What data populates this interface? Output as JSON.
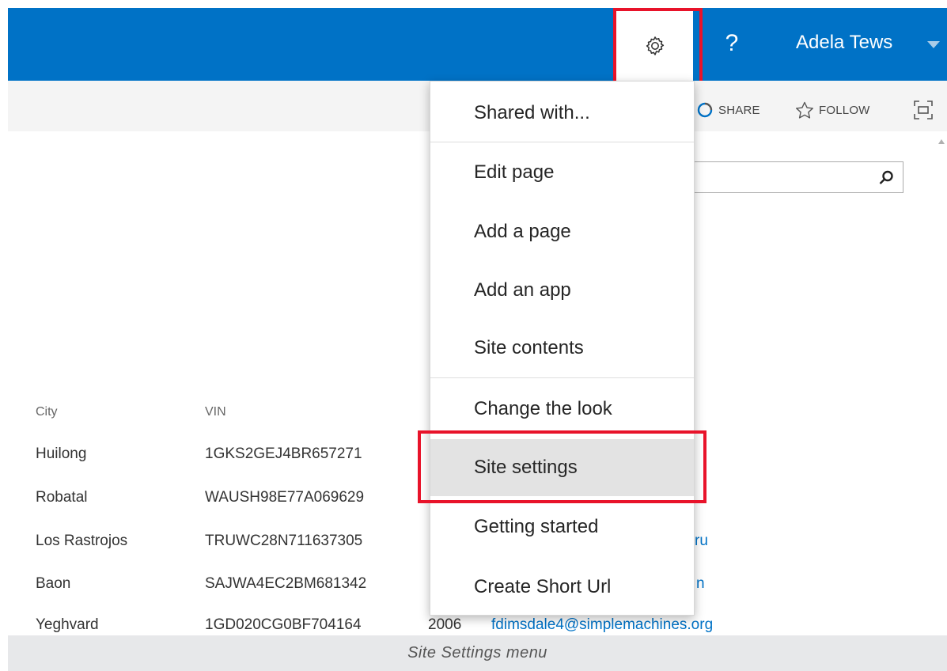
{
  "suitebar": {
    "help_label": "?",
    "user_name": "Adela Tews",
    "brand_color": "#0072c6",
    "icons": [
      "gear-icon",
      "help-icon",
      "caret-down-icon"
    ]
  },
  "actionbar": {
    "share_label": "SHARE",
    "follow_label": "FOLLOW",
    "icons": [
      "share-icon",
      "star-icon",
      "focus-icon"
    ]
  },
  "search": {
    "placeholder": "",
    "icon": "search-icon"
  },
  "list": {
    "headers": [
      "City",
      "VIN"
    ],
    "rows": [
      {
        "city": "Huilong",
        "vin": "1GKS2GEJ4BR657271",
        "year": "",
        "email": ""
      },
      {
        "city": "Robatal",
        "vin": "WAUSH98E77A069629",
        "year": "",
        "email": ""
      },
      {
        "city": "Los Rastrojos",
        "vin": "TRUWC28N711637305",
        "year": "",
        "email": "ru"
      },
      {
        "city": "Baon",
        "vin": "SAJWA4EC2BM681342",
        "year": "",
        "email": "n"
      },
      {
        "city": "Yeghvard",
        "vin": "1GD020CG0BF704164",
        "year": "2006",
        "email": "fdimsdale4@simplemachines.org"
      }
    ]
  },
  "menu": {
    "items": [
      "Shared with...",
      "Edit page",
      "Add a page",
      "Add an app",
      "Site contents",
      "Change the look",
      "Site settings",
      "Getting started",
      "Create Short Url"
    ],
    "highlighted": "Site settings",
    "highlight_color": "#e8132a"
  },
  "caption": "Site Settings menu"
}
